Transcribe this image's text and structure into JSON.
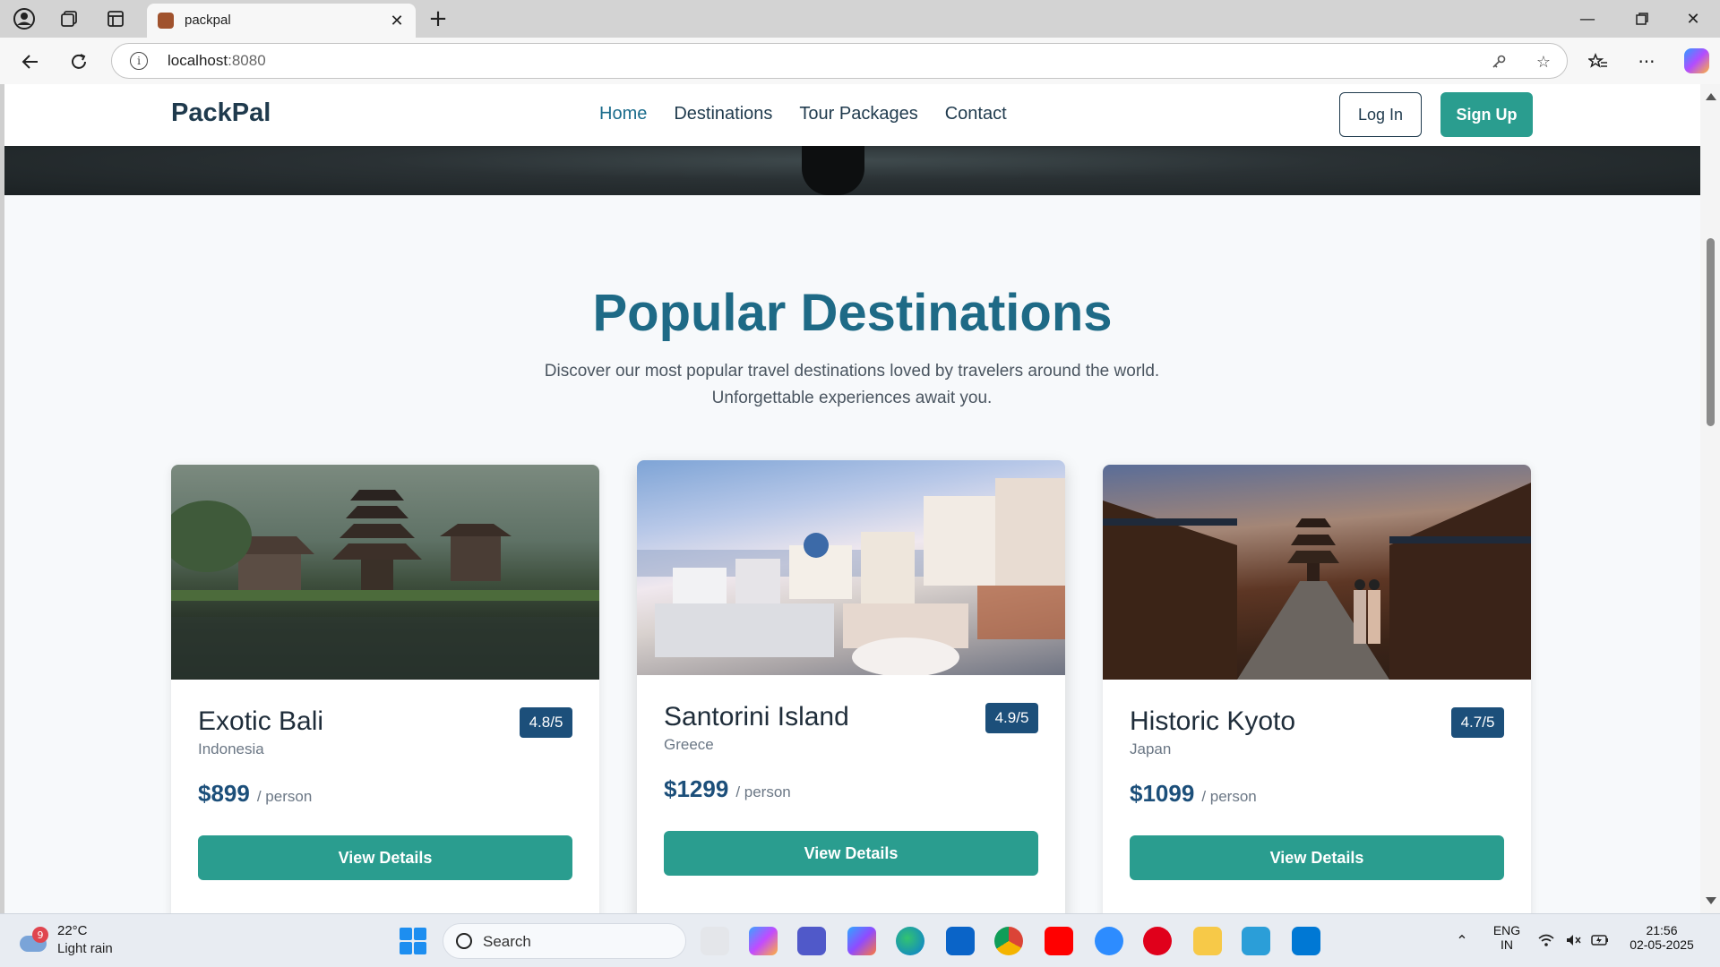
{
  "browser": {
    "tab_title": "packpal",
    "url_host": "localhost",
    "url_port": ":8080"
  },
  "site": {
    "brand": "PackPal",
    "nav": [
      "Home",
      "Destinations",
      "Tour Packages",
      "Contact"
    ],
    "login_label": "Log In",
    "signup_label": "Sign Up",
    "accent_color": "#2a9d8f",
    "primary_color": "#1c4f7a"
  },
  "section": {
    "title": "Popular Destinations",
    "subtitle_line1": "Discover our most popular travel destinations loved by travelers around the world.",
    "subtitle_line2": "Unforgettable experiences await you."
  },
  "cards": [
    {
      "name": "Exotic Bali",
      "country": "Indonesia",
      "rating": "4.8/5",
      "price": "$899",
      "unit": "/ person",
      "button": "View Details"
    },
    {
      "name": "Santorini Island",
      "country": "Greece",
      "rating": "4.9/5",
      "price": "$1299",
      "unit": "/ person",
      "button": "View Details"
    },
    {
      "name": "Historic Kyoto",
      "country": "Japan",
      "rating": "4.7/5",
      "price": "$1099",
      "unit": "/ person",
      "button": "View Details"
    }
  ],
  "taskbar": {
    "weather_badge": "9",
    "temperature": "22°C",
    "weather": "Light rain",
    "search_label": "Search",
    "lang_line1": "ENG",
    "lang_line2": "IN",
    "time": "21:56",
    "date": "02-05-2025"
  }
}
